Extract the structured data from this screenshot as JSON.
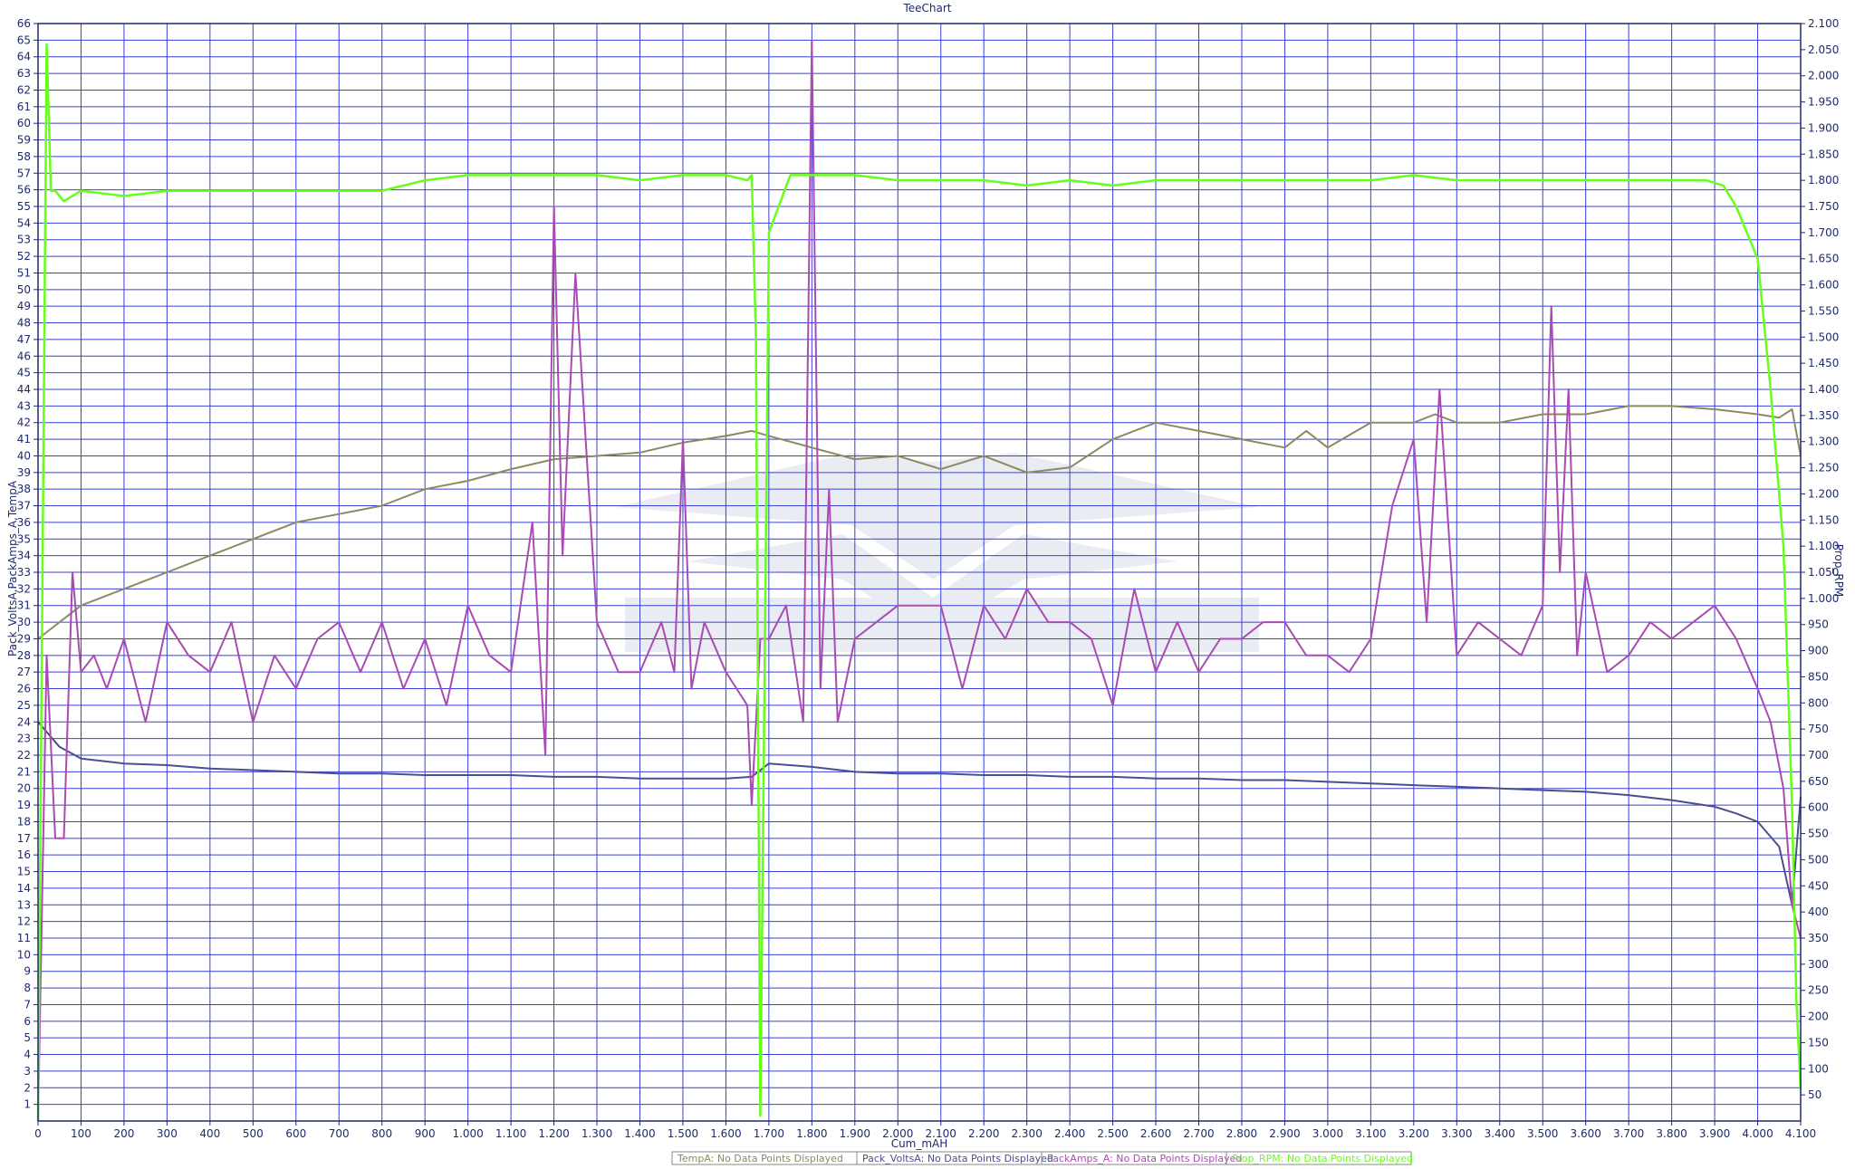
{
  "chart_data": {
    "type": "line",
    "title": "TeeChart",
    "xlabel": "Cum_mAH",
    "ylabel_left": "Pack_VoltsA,PackAmps_A,TempA",
    "ylabel_right": "Prop_RPM",
    "xlim": [
      0,
      4100
    ],
    "ylim_left": [
      0,
      66
    ],
    "ylim_right": [
      0,
      2100
    ],
    "grid": true,
    "x_ticks": [
      0,
      100,
      200,
      300,
      400,
      500,
      600,
      700,
      800,
      900,
      1000,
      1100,
      1200,
      1300,
      1400,
      1500,
      1600,
      1700,
      1800,
      1900,
      2000,
      2100,
      2200,
      2300,
      2400,
      2500,
      2600,
      2700,
      2800,
      2900,
      3000,
      3100,
      3200,
      3300,
      3400,
      3500,
      3600,
      3700,
      3800,
      3900,
      4000,
      4100
    ],
    "x_tick_labels": [
      "0",
      "100",
      "200",
      "300",
      "400",
      "500",
      "600",
      "700",
      "800",
      "900",
      "1.000",
      "1.100",
      "1.200",
      "1.300",
      "1.400",
      "1.500",
      "1.600",
      "1.700",
      "1.800",
      "1.900",
      "2.000",
      "2.100",
      "2.200",
      "2.300",
      "2.400",
      "2.500",
      "2.600",
      "2.700",
      "2.800",
      "2.900",
      "3.000",
      "3.100",
      "3.200",
      "3.300",
      "3.400",
      "3.500",
      "3.600",
      "3.700",
      "3.800",
      "3.900",
      "4.000",
      "4.100"
    ],
    "right_ticks": [
      50,
      100,
      150,
      200,
      250,
      300,
      350,
      400,
      450,
      500,
      550,
      600,
      650,
      700,
      750,
      800,
      850,
      900,
      950,
      1000,
      1050,
      1100,
      1150,
      1200,
      1250,
      1300,
      1350,
      1400,
      1450,
      1500,
      1550,
      1600,
      1650,
      1700,
      1750,
      1800,
      1850,
      1900,
      1950,
      2000,
      2050,
      2100
    ],
    "right_tick_labels": [
      "50",
      "100",
      "150",
      "200",
      "250",
      "300",
      "350",
      "400",
      "450",
      "500",
      "550",
      "600",
      "650",
      "700",
      "750",
      "800",
      "850",
      "900",
      "950",
      "1.000",
      "1.050",
      "1.100",
      "1.150",
      "1.200",
      "1.250",
      "1.300",
      "1.350",
      "1.400",
      "1.450",
      "1.500",
      "1.550",
      "1.600",
      "1.650",
      "1.700",
      "1.750",
      "1.800",
      "1.850",
      "1.900",
      "1.950",
      "2.000",
      "2.050",
      "2.100"
    ],
    "series": [
      {
        "name": "TempA",
        "axis": "left",
        "color": "#8c8a5e",
        "x": [
          0,
          100,
          200,
          300,
          400,
          500,
          600,
          700,
          800,
          900,
          1000,
          1100,
          1200,
          1300,
          1400,
          1500,
          1600,
          1660,
          1700,
          1800,
          1900,
          2000,
          2100,
          2200,
          2300,
          2400,
          2500,
          2600,
          2700,
          2800,
          2900,
          2950,
          3000,
          3100,
          3200,
          3250,
          3300,
          3400,
          3500,
          3600,
          3700,
          3800,
          3900,
          4000,
          4050,
          4080,
          4100
        ],
        "values": [
          29,
          31,
          32,
          33,
          34,
          35,
          36,
          36.5,
          37,
          38,
          38.5,
          39.2,
          39.8,
          40,
          40.2,
          40.8,
          41.2,
          41.5,
          41.2,
          40.5,
          39.8,
          40,
          39.2,
          40,
          39,
          39.3,
          41,
          42,
          41.5,
          41,
          40.5,
          41.5,
          40.5,
          42,
          42,
          42.5,
          42,
          42,
          42.5,
          42.5,
          43,
          43,
          42.8,
          42.5,
          42.3,
          42.8,
          40
        ]
      },
      {
        "name": "Pack_VoltsA",
        "axis": "left",
        "color": "#4a4f8c",
        "x": [
          0,
          50,
          100,
          200,
          300,
          400,
          500,
          600,
          700,
          800,
          900,
          1000,
          1100,
          1200,
          1300,
          1400,
          1500,
          1600,
          1660,
          1700,
          1800,
          1900,
          2000,
          2100,
          2200,
          2300,
          2400,
          2500,
          2600,
          2700,
          2800,
          2900,
          3000,
          3100,
          3200,
          3300,
          3400,
          3500,
          3600,
          3700,
          3800,
          3900,
          3950,
          4000,
          4050,
          4080,
          4100
        ],
        "values": [
          24,
          22.5,
          21.8,
          21.5,
          21.4,
          21.2,
          21.1,
          21,
          20.9,
          20.9,
          20.8,
          20.8,
          20.8,
          20.7,
          20.7,
          20.6,
          20.6,
          20.6,
          20.7,
          21.5,
          21.3,
          21,
          20.9,
          20.9,
          20.8,
          20.8,
          20.7,
          20.7,
          20.6,
          20.6,
          20.5,
          20.5,
          20.4,
          20.3,
          20.2,
          20.1,
          20,
          19.9,
          19.8,
          19.6,
          19.3,
          18.9,
          18.5,
          18,
          16.5,
          13,
          19.5
        ]
      },
      {
        "name": "PackAmps_A",
        "axis": "left",
        "color": "#a94bb3",
        "x": [
          0,
          20,
          40,
          60,
          80,
          100,
          130,
          160,
          200,
          250,
          300,
          350,
          400,
          450,
          500,
          550,
          600,
          650,
          700,
          750,
          800,
          850,
          900,
          950,
          1000,
          1050,
          1100,
          1150,
          1180,
          1200,
          1220,
          1250,
          1300,
          1350,
          1400,
          1450,
          1480,
          1500,
          1520,
          1550,
          1600,
          1650,
          1660,
          1680,
          1700,
          1740,
          1780,
          1800,
          1820,
          1840,
          1860,
          1900,
          1950,
          2000,
          2050,
          2100,
          2150,
          2200,
          2250,
          2300,
          2350,
          2400,
          2450,
          2500,
          2550,
          2600,
          2650,
          2700,
          2750,
          2800,
          2850,
          2900,
          2950,
          3000,
          3050,
          3100,
          3150,
          3200,
          3230,
          3260,
          3300,
          3350,
          3400,
          3450,
          3500,
          3520,
          3540,
          3560,
          3580,
          3600,
          3650,
          3700,
          3750,
          3800,
          3850,
          3900,
          3950,
          4000,
          4030,
          4060,
          4080,
          4100
        ],
        "values": [
          0,
          28,
          17,
          17,
          33,
          27,
          28,
          26,
          29,
          24,
          30,
          28,
          27,
          30,
          24,
          28,
          26,
          29,
          30,
          27,
          30,
          26,
          29,
          25,
          31,
          28,
          27,
          36,
          22,
          55,
          34,
          51,
          30,
          27,
          27,
          30,
          27,
          41,
          26,
          30,
          27,
          25,
          19,
          29,
          29,
          31,
          24,
          65,
          26,
          38,
          24,
          29,
          30,
          31,
          31,
          31,
          26,
          31,
          29,
          32,
          30,
          30,
          29,
          25,
          32,
          27,
          30,
          27,
          29,
          29,
          30,
          30,
          28,
          28,
          27,
          29,
          37,
          41,
          30,
          44,
          28,
          30,
          29,
          28,
          31,
          49,
          33,
          44,
          28,
          33,
          27,
          28,
          30,
          29,
          30,
          31,
          29,
          26,
          24,
          20,
          13,
          11
        ]
      },
      {
        "name": "Prop_RPM",
        "axis": "right",
        "color": "#66ff1a",
        "x": [
          0,
          10,
          20,
          30,
          40,
          60,
          100,
          200,
          300,
          400,
          500,
          600,
          700,
          800,
          900,
          1000,
          1100,
          1200,
          1300,
          1400,
          1500,
          1600,
          1650,
          1660,
          1670,
          1680,
          1700,
          1750,
          1800,
          1900,
          2000,
          2100,
          2200,
          2300,
          2400,
          2500,
          2600,
          2700,
          2800,
          2900,
          3000,
          3100,
          3200,
          3300,
          3400,
          3500,
          3600,
          3700,
          3800,
          3880,
          3920,
          3950,
          4000,
          4030,
          4060,
          4080,
          4090,
          4100
        ],
        "values": [
          0,
          1000,
          2060,
          1780,
          1780,
          1760,
          1780,
          1770,
          1780,
          1780,
          1780,
          1780,
          1780,
          1780,
          1800,
          1810,
          1810,
          1810,
          1810,
          1800,
          1810,
          1810,
          1800,
          1810,
          1500,
          10,
          1700,
          1810,
          1810,
          1810,
          1800,
          1800,
          1800,
          1790,
          1800,
          1790,
          1800,
          1800,
          1800,
          1800,
          1800,
          1800,
          1810,
          1800,
          1800,
          1800,
          1800,
          1800,
          1800,
          1800,
          1790,
          1750,
          1650,
          1400,
          1100,
          600,
          230,
          60
        ]
      }
    ],
    "legend": {
      "placement": "bottom",
      "items": [
        {
          "series": "TempA",
          "text": "TempA: No Data Points Displayed",
          "color": "#8c8a5e"
        },
        {
          "series": "Pack_VoltsA",
          "text": "Pack_VoltsA: No Data Points Displayed",
          "color": "#4a4f8c"
        },
        {
          "series": "PackAmps_A",
          "text": "PackAmps_A: No Data Points Displayed",
          "color": "#a94bb3"
        },
        {
          "series": "Prop_RPM",
          "text": "Prop_RPM: No Data Points Displayed",
          "color": "#66ff1a"
        }
      ]
    },
    "colors": {
      "grid": "#3a3fd9",
      "frame": "#1f2a6e",
      "text": "#1f2a6e"
    }
  }
}
